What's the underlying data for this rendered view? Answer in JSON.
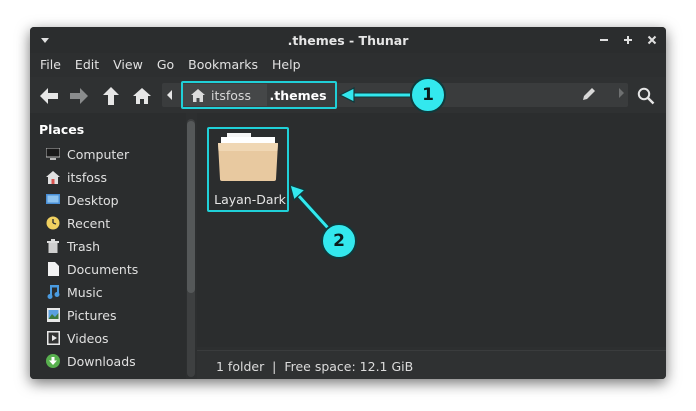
{
  "window": {
    "title": ".themes - Thunar"
  },
  "menubar": {
    "items": [
      "File",
      "Edit",
      "View",
      "Go",
      "Bookmarks",
      "Help"
    ]
  },
  "pathbar": {
    "crumbs": [
      "itsfoss",
      ".themes"
    ]
  },
  "sidebar": {
    "heading": "Places",
    "items": [
      {
        "label": "Computer",
        "icon": "computer-icon"
      },
      {
        "label": "itsfoss",
        "icon": "home-folder-icon"
      },
      {
        "label": "Desktop",
        "icon": "desktop-icon"
      },
      {
        "label": "Recent",
        "icon": "recent-icon"
      },
      {
        "label": "Trash",
        "icon": "trash-icon"
      },
      {
        "label": "Documents",
        "icon": "documents-icon"
      },
      {
        "label": "Music",
        "icon": "music-icon"
      },
      {
        "label": "Pictures",
        "icon": "pictures-icon"
      },
      {
        "label": "Videos",
        "icon": "videos-icon"
      },
      {
        "label": "Downloads",
        "icon": "downloads-icon"
      }
    ]
  },
  "content": {
    "items": [
      {
        "name": "Layan-Dark",
        "icon": "folder-icon"
      }
    ]
  },
  "statusbar": {
    "text": "1 folder  |  Free space: 12.1 GiB"
  },
  "annotations": {
    "callouts": [
      "1",
      "2"
    ],
    "accent_color": "#33e8ee"
  }
}
